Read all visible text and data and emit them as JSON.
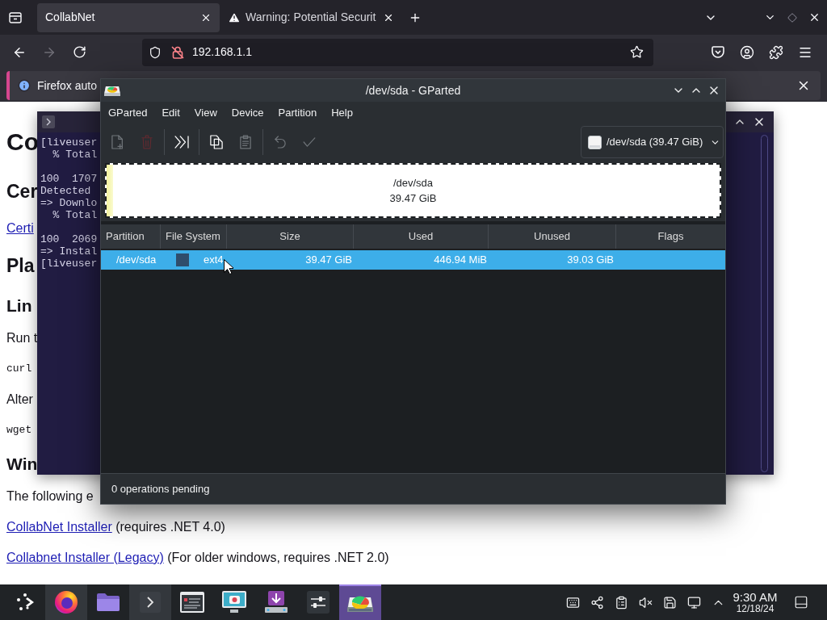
{
  "browser": {
    "tabs": [
      {
        "kind": "page",
        "label": "CollabNet",
        "selected": true
      },
      {
        "kind": "warning",
        "label": "Warning: Potential Securit",
        "selected": false
      }
    ],
    "url": "192.168.1.1",
    "notification": "Firefox auto"
  },
  "page": {
    "blocks": [
      {
        "kind": "h1",
        "text": "Co"
      },
      {
        "kind": "h2",
        "text": "Cer"
      },
      {
        "kind": "link",
        "text": "Certi"
      },
      {
        "kind": "h2",
        "text": "Pla"
      },
      {
        "kind": "h3",
        "text": "Lin"
      },
      {
        "kind": "p",
        "text": "Run t"
      },
      {
        "kind": "code",
        "text": "curl"
      },
      {
        "kind": "p",
        "text": "Alter"
      },
      {
        "kind": "code",
        "text": "wget"
      },
      {
        "kind": "h3",
        "text": "Win"
      },
      {
        "kind": "p",
        "text": "The following e"
      },
      {
        "kind": "download",
        "link": "CollabNet Installer",
        "note": "(requires .NET 4.0)"
      },
      {
        "kind": "download",
        "link": "Collabnet Installer (Legacy)",
        "note": "(For older windows, requires .NET 2.0)"
      }
    ]
  },
  "terminal": {
    "lines": [
      {
        "text": "[liveuser"
      },
      {
        "text": "  % Total"
      },
      {
        "text": "100  1707",
        "gap_before": true
      },
      {
        "text": "Detected"
      },
      {
        "text": "=> Downlo"
      },
      {
        "text": "  % Total"
      },
      {
        "text": "100  2069",
        "gap_before": true
      },
      {
        "text": "=> Instal"
      },
      {
        "text": "[liveuser"
      }
    ]
  },
  "gparted": {
    "title": "/dev/sda - GParted",
    "menu": [
      "GParted",
      "Edit",
      "View",
      "Device",
      "Partition",
      "Help"
    ],
    "toolbar": [
      {
        "kind": "new",
        "disabled": true
      },
      {
        "kind": "delete",
        "disabled": true
      },
      {
        "kind": "separator"
      },
      {
        "kind": "resize",
        "disabled": false
      },
      {
        "kind": "separator"
      },
      {
        "kind": "copy",
        "disabled": false
      },
      {
        "kind": "paste",
        "disabled": true
      },
      {
        "kind": "separator"
      },
      {
        "kind": "undo",
        "disabled": true
      },
      {
        "kind": "apply",
        "disabled": true
      }
    ],
    "device": "/dev/sda (39.47 GiB)",
    "disk_map": {
      "name": "/dev/sda",
      "size": "39.47 GiB",
      "level": 0.011
    },
    "columns": [
      "Partition",
      "File System",
      "Size",
      "Used",
      "Unused",
      "Flags"
    ],
    "rows": [
      {
        "selected": true,
        "partition": "/dev/sda",
        "color": "#2f4d6c",
        "file_system": "ext4",
        "size": "39.47 GiB",
        "used": "446.94 MiB",
        "unused": "39.03 GiB"
      }
    ],
    "status": "0 operations pending"
  },
  "taskbar": {
    "apps": [
      {
        "kind": "launcher",
        "running": false,
        "selected": false
      },
      {
        "kind": "browser",
        "running": true,
        "selected": false
      },
      {
        "kind": "files",
        "running": false,
        "selected": false
      },
      {
        "kind": "terminal",
        "running": true,
        "selected": false
      },
      {
        "kind": "monitor",
        "running": false,
        "selected": false
      },
      {
        "kind": "screenshot",
        "running": false,
        "selected": false
      },
      {
        "kind": "installer",
        "running": false,
        "selected": false
      },
      {
        "kind": "settings",
        "running": false,
        "selected": false
      },
      {
        "kind": "partition",
        "running": true,
        "selected": true
      }
    ],
    "tray": [
      {
        "kind": "keyboard"
      },
      {
        "kind": "share"
      },
      {
        "kind": "clipboard"
      },
      {
        "kind": "muted"
      },
      {
        "kind": "disk"
      },
      {
        "kind": "network"
      },
      {
        "kind": "expand"
      }
    ],
    "clock": {
      "time": "9:30 AM",
      "date": "12/18/24"
    }
  }
}
